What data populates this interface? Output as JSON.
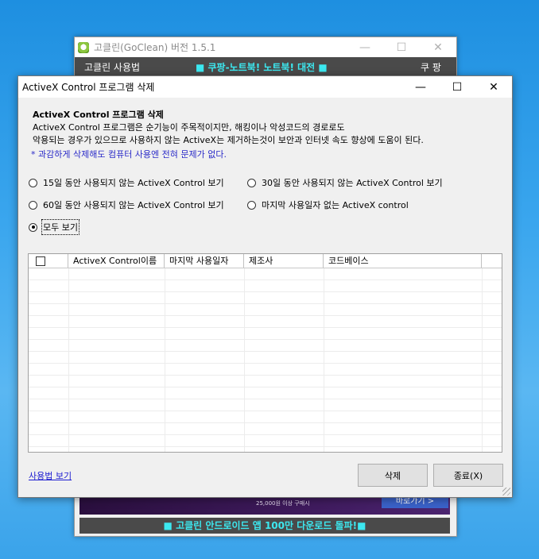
{
  "bg_window": {
    "title": "고클린(GoClean) 버전 1.5.1",
    "menu_left": "고클린 사용법",
    "ticker": "■ 쿠팡-노트북! 노트북! 대전 ■",
    "menu_right": "쿠 팡",
    "ad_text": "25,000원 이상 구매시",
    "ad_button": "바로가기 >",
    "bottom_bar": "■ 고클린 안드로이드 앱 100만 다운로드 돌파!■"
  },
  "dialog": {
    "title": "ActiveX Control 프로그램 삭제",
    "header": "ActiveX Control 프로그램 삭제",
    "desc1": "ActiveX Control 프로그램은 순기능이 주목적이지만, 해킹이나 악성코드의 경로로도",
    "desc2": "악용되는 경우가 있으므로 사용하지 않는 ActiveX는 제거하는것이 보안과 인터넷 속도 향상에 도움이 된다.",
    "note": "* 과감하게 삭제해도 컴퓨터 사용엔 전혀 문제가 없다.",
    "radios": [
      {
        "label": "15일 동안 사용되지 않는 ActiveX Control 보기",
        "selected": false
      },
      {
        "label": "30일 동안 사용되지 않는 ActiveX Control 보기",
        "selected": false
      },
      {
        "label": "60일 동안 사용되지 않는 ActiveX Control 보기",
        "selected": false
      },
      {
        "label": "마지막 사용일자 없는 ActiveX control",
        "selected": false
      },
      {
        "label": "모두 보기",
        "selected": true
      }
    ],
    "columns": [
      "ActiveX Control이름",
      "마지막 사용일자",
      "제조사",
      "코드베이스"
    ],
    "help_link": "사용법 보기",
    "delete_button": "삭제",
    "close_button": "종료(X)"
  }
}
